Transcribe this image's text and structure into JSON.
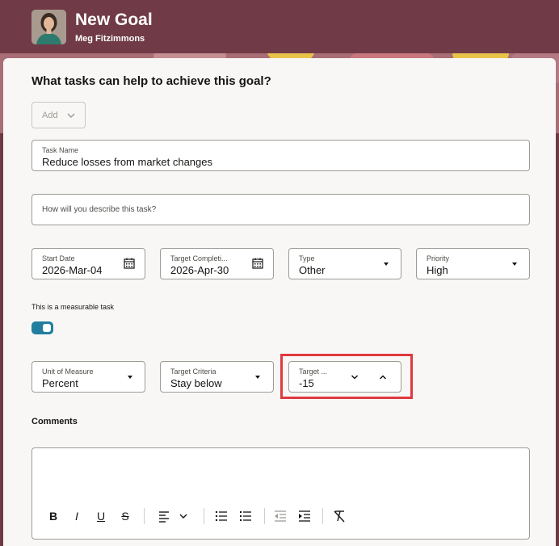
{
  "header": {
    "title": "New Goal",
    "user_name": "Meg Fitzimmons"
  },
  "section": {
    "heading": "What tasks can help to achieve this goal?",
    "add_label": "Add"
  },
  "task_name": {
    "label": "Task Name",
    "value": "Reduce losses from market changes"
  },
  "description": {
    "placeholder": "How will you describe this task?"
  },
  "start_date": {
    "label": "Start Date",
    "value": "2026-Mar-04"
  },
  "target_completion": {
    "label": "Target Completi...",
    "value": "2026-Apr-30"
  },
  "type": {
    "label": "Type",
    "value": "Other"
  },
  "priority": {
    "label": "Priority",
    "value": "High"
  },
  "measurable": {
    "label": "This is a measurable task",
    "enabled": true
  },
  "unit_of_measure": {
    "label": "Unit of Measure",
    "value": "Percent"
  },
  "target_criteria": {
    "label": "Target Criteria",
    "value": "Stay below"
  },
  "target_value": {
    "label": "Target ...",
    "value": "-15"
  },
  "comments": {
    "label": "Comments"
  },
  "toolbar": {
    "bold": "B",
    "italic": "I",
    "underline": "U",
    "strikethrough": "S"
  },
  "colors": {
    "header_bg": "#703b46",
    "accent": "#227e9e",
    "highlight": "#e0393e"
  }
}
